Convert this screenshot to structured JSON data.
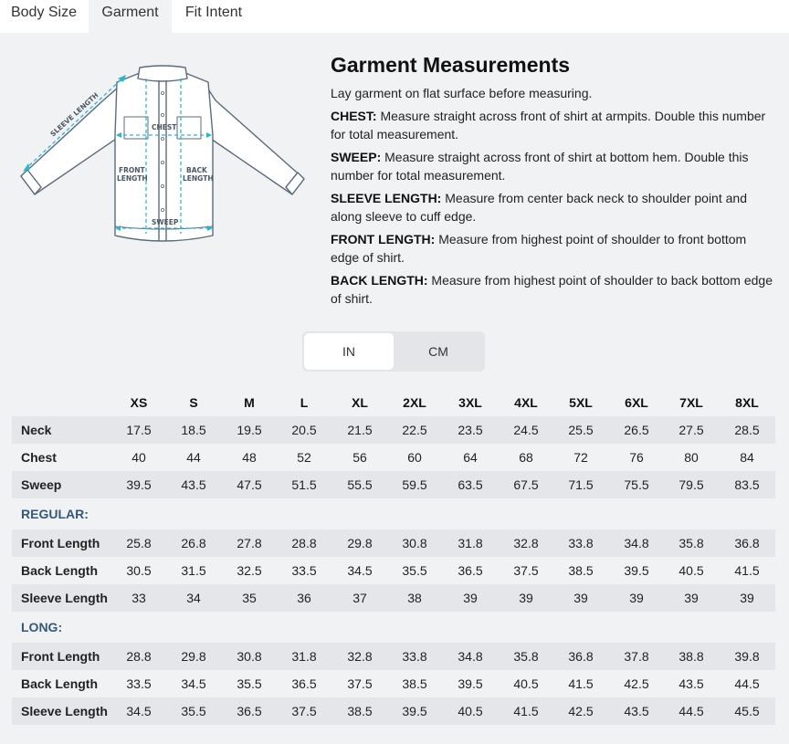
{
  "tabs": [
    {
      "label": "Body Size",
      "active": false
    },
    {
      "label": "Garment",
      "active": true
    },
    {
      "label": "Fit Intent",
      "active": false
    }
  ],
  "diagram": {
    "sleeve_length": "SLEEVE LENGTH",
    "chest": "CHEST",
    "front_length_1": "FRONT",
    "front_length_2": "LENGTH",
    "back_length_1": "BACK",
    "back_length_2": "LENGTH",
    "sweep": "SWEEP",
    "line_color": "#5b6b7b",
    "measure_color": "#29b6d6"
  },
  "content": {
    "title": "Garment Measurements",
    "intro": "Lay garment on flat surface before measuring.",
    "items": [
      {
        "term": "CHEST:",
        "text": " Measure straight across front of shirt at armpits. Double this number for total measurement."
      },
      {
        "term": "SWEEP:",
        "text": " Measure straight across front of shirt at bottom hem. Double this number for total measurement."
      },
      {
        "term": "SLEEVE LENGTH:",
        "text": " Measure from center back neck to shoulder point and along sleeve to cuff edge."
      },
      {
        "term": "FRONT LENGTH:",
        "text": " Measure from highest point of shoulder to front bottom edge of shirt."
      },
      {
        "term": "BACK LENGTH:",
        "text": " Measure from highest point of shoulder to back bottom edge of shirt."
      }
    ]
  },
  "units": {
    "in_label": "IN",
    "cm_label": "CM",
    "selected": "IN"
  },
  "table": {
    "sizes": [
      "XS",
      "S",
      "M",
      "L",
      "XL",
      "2XL",
      "3XL",
      "4XL",
      "5XL",
      "6XL",
      "7XL",
      "8XL"
    ],
    "general": [
      {
        "label": "Neck",
        "values": [
          "17.5",
          "18.5",
          "19.5",
          "20.5",
          "21.5",
          "22.5",
          "23.5",
          "24.5",
          "25.5",
          "26.5",
          "27.5",
          "28.5"
        ]
      },
      {
        "label": "Chest",
        "values": [
          "40",
          "44",
          "48",
          "52",
          "56",
          "60",
          "64",
          "68",
          "72",
          "76",
          "80",
          "84"
        ]
      },
      {
        "label": "Sweep",
        "values": [
          "39.5",
          "43.5",
          "47.5",
          "51.5",
          "55.5",
          "59.5",
          "63.5",
          "67.5",
          "71.5",
          "75.5",
          "79.5",
          "83.5"
        ]
      }
    ],
    "regular_label": "REGULAR:",
    "regular": [
      {
        "label": "Front Length",
        "values": [
          "25.8",
          "26.8",
          "27.8",
          "28.8",
          "29.8",
          "30.8",
          "31.8",
          "32.8",
          "33.8",
          "34.8",
          "35.8",
          "36.8"
        ]
      },
      {
        "label": "Back Length",
        "values": [
          "30.5",
          "31.5",
          "32.5",
          "33.5",
          "34.5",
          "35.5",
          "36.5",
          "37.5",
          "38.5",
          "39.5",
          "40.5",
          "41.5"
        ]
      },
      {
        "label": "Sleeve Length",
        "values": [
          "33",
          "34",
          "35",
          "36",
          "37",
          "38",
          "39",
          "39",
          "39",
          "39",
          "39",
          "39"
        ]
      }
    ],
    "long_label": "LONG:",
    "long": [
      {
        "label": "Front Length",
        "values": [
          "28.8",
          "29.8",
          "30.8",
          "31.8",
          "32.8",
          "33.8",
          "34.8",
          "35.8",
          "36.8",
          "37.8",
          "38.8",
          "39.8"
        ]
      },
      {
        "label": "Back Length",
        "values": [
          "33.5",
          "34.5",
          "35.5",
          "36.5",
          "37.5",
          "38.5",
          "39.5",
          "40.5",
          "41.5",
          "42.5",
          "43.5",
          "44.5"
        ]
      },
      {
        "label": "Sleeve Length",
        "values": [
          "34.5",
          "35.5",
          "36.5",
          "37.5",
          "38.5",
          "39.5",
          "40.5",
          "41.5",
          "42.5",
          "43.5",
          "44.5",
          "45.5"
        ]
      }
    ]
  }
}
